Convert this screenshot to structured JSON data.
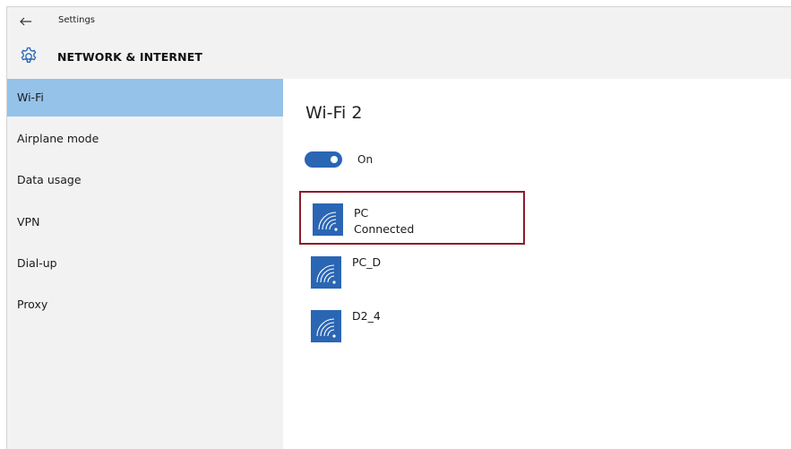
{
  "app": {
    "title": "Settings",
    "back_icon": "back-arrow-icon"
  },
  "section": {
    "title": "NETWORK & INTERNET",
    "icon": "gear-icon"
  },
  "sidebar": {
    "items": [
      {
        "label": "Wi-Fi",
        "active": true
      },
      {
        "label": "Airplane mode",
        "active": false
      },
      {
        "label": "Data usage",
        "active": false
      },
      {
        "label": "VPN",
        "active": false
      },
      {
        "label": "Dial-up",
        "active": false
      },
      {
        "label": "Proxy",
        "active": false
      }
    ]
  },
  "main": {
    "heading": "Wi-Fi 2",
    "toggle": {
      "state": "on",
      "label": "On"
    },
    "networks": [
      {
        "name": "PC",
        "status": "Connected",
        "icon": "wifi-icon",
        "highlighted": true
      },
      {
        "name": "PC_D",
        "icon": "wifi-icon"
      },
      {
        "name": "D2_4",
        "icon": "wifi-icon"
      }
    ]
  },
  "colors": {
    "accent": "#2a66b4",
    "sidebar_active": "#95c2e9",
    "header_bg": "#f2f2f2",
    "highlight_border": "#8b1d2c"
  }
}
